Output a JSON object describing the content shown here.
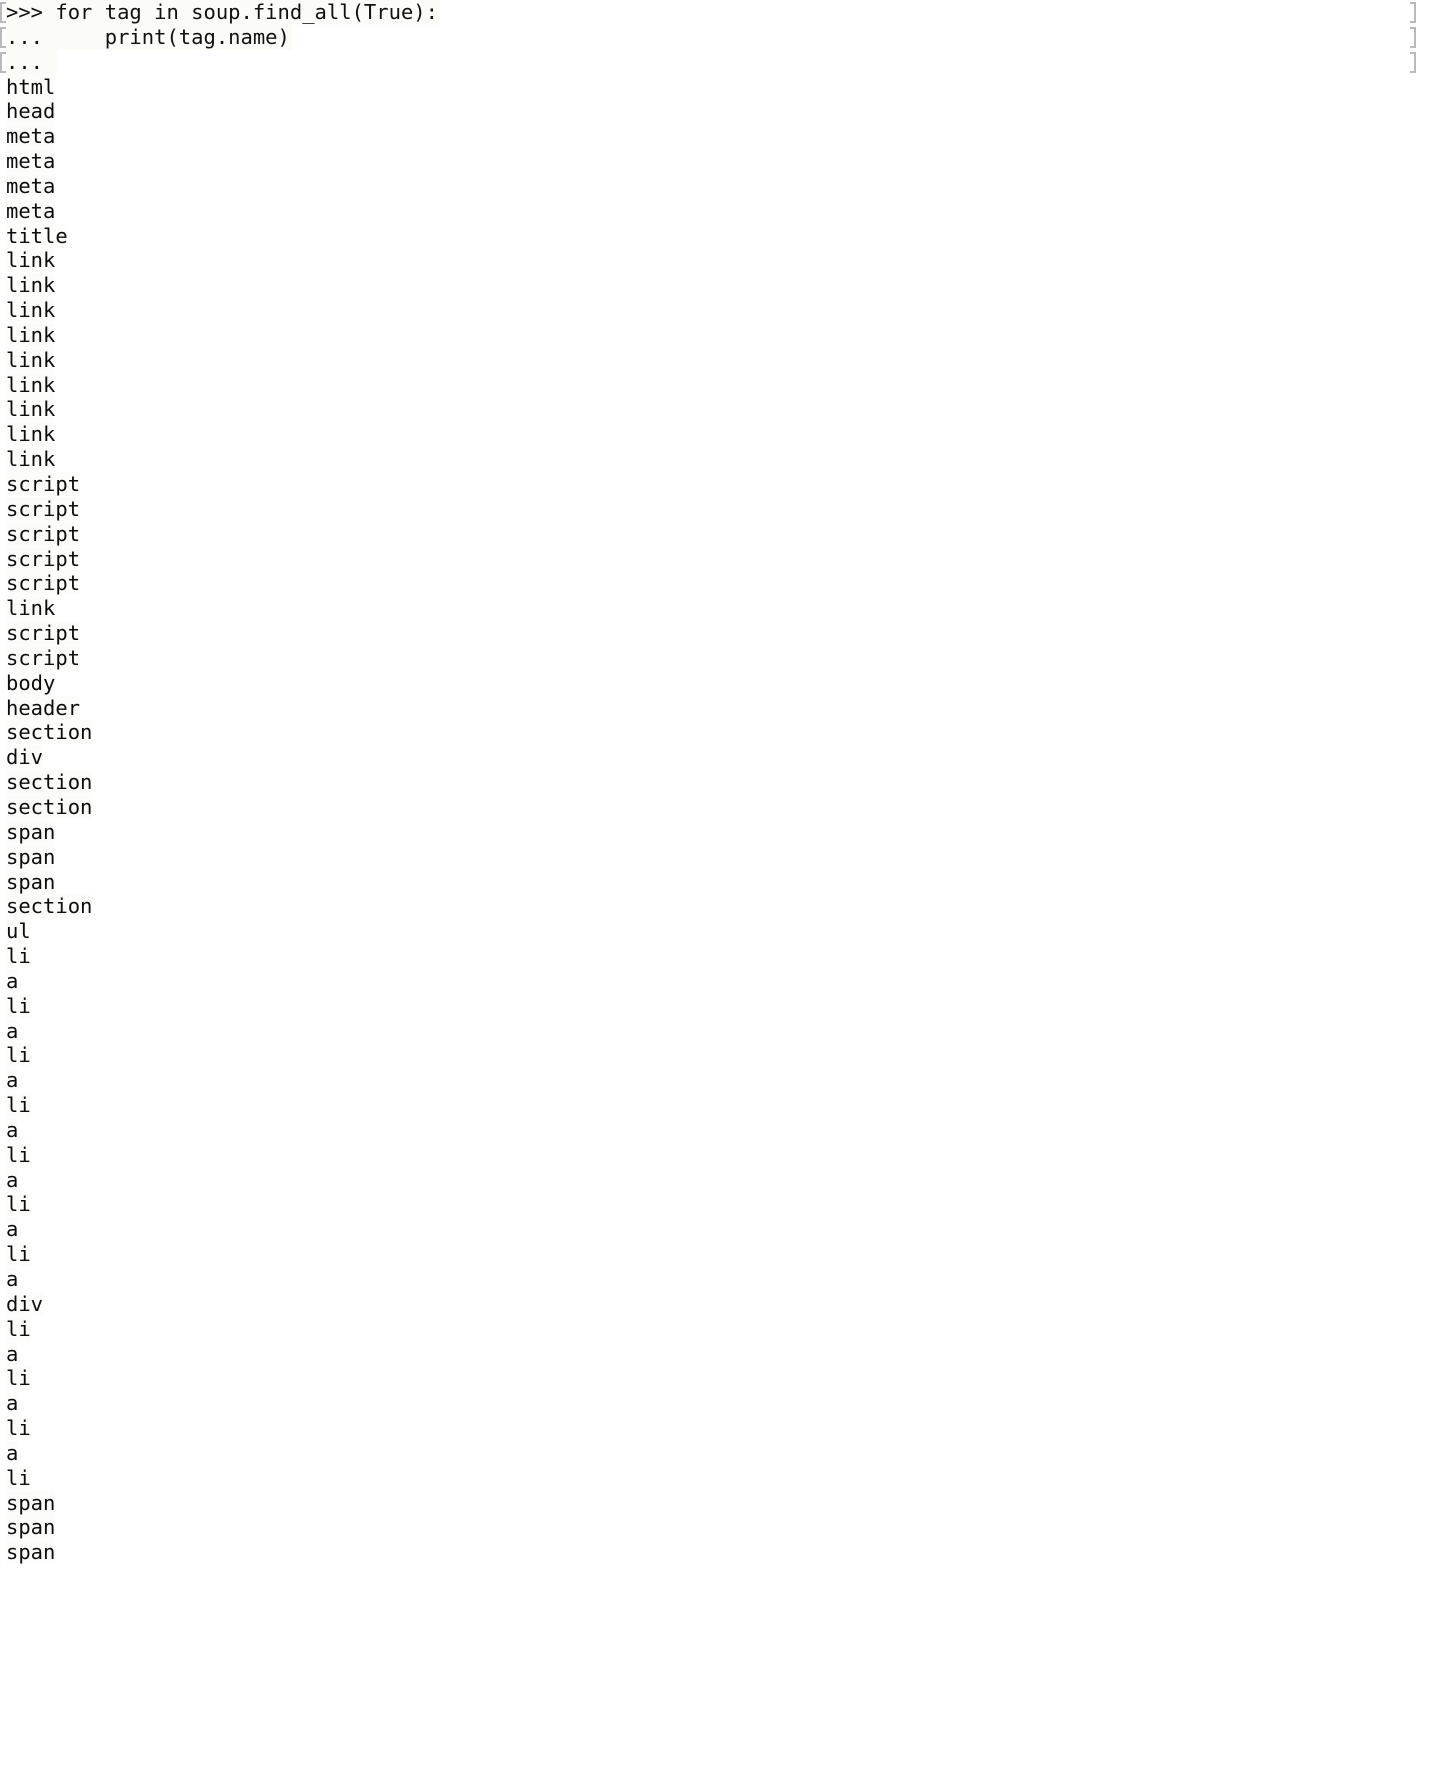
{
  "session": {
    "kind": "python-repl",
    "prompt_primary": ">>> ",
    "prompt_continuation": "... ",
    "font_color": "#0d0d0d",
    "background_color": "#ffffff",
    "code_background_color": "#fbfbf8",
    "bracket_color": "#b9b9b9"
  },
  "input_lines": [
    {
      "prompt": ">>> ",
      "code": "for tag in soup.find_all(True):"
    },
    {
      "prompt": "... ",
      "code": "    print(tag.name)"
    },
    {
      "prompt": "... ",
      "code": ""
    }
  ],
  "output_lines": [
    "html",
    "head",
    "meta",
    "meta",
    "meta",
    "meta",
    "title",
    "link",
    "link",
    "link",
    "link",
    "link",
    "link",
    "link",
    "link",
    "link",
    "script",
    "script",
    "script",
    "script",
    "script",
    "link",
    "script",
    "script",
    "body",
    "header",
    "section",
    "div",
    "section",
    "section",
    "span",
    "span",
    "span",
    "section",
    "ul",
    "li",
    "a",
    "li",
    "a",
    "li",
    "a",
    "li",
    "a",
    "li",
    "a",
    "li",
    "a",
    "li",
    "a",
    "div",
    "li",
    "a",
    "li",
    "a",
    "li",
    "a",
    "li",
    "span",
    "span",
    "span"
  ]
}
